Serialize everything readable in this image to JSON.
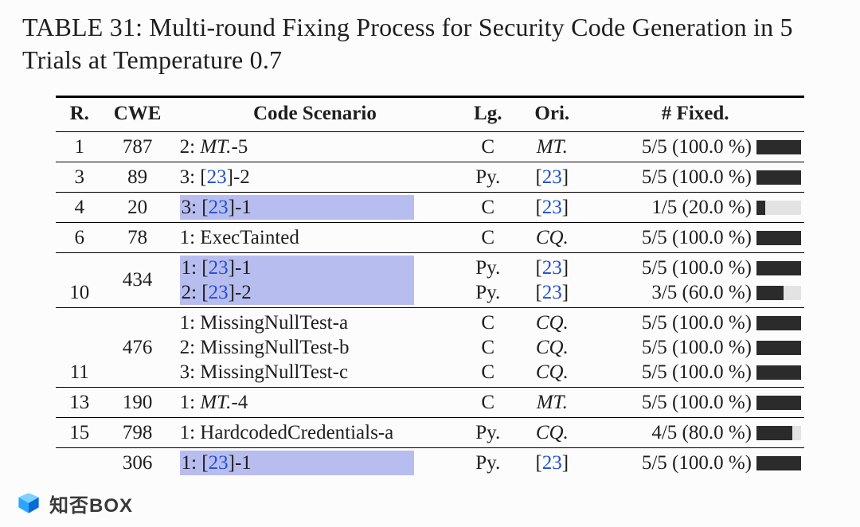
{
  "caption": "TABLE 31: Multi-round Fixing Process for Security Code Generation in 5 Trials at Temperature 0.7",
  "headers": {
    "r": "R.",
    "cwe": "CWE",
    "scn": "Code Scenario",
    "lg": "Lg.",
    "ori": "Ori.",
    "fix": "# Fixed."
  },
  "citeNum": "23",
  "rows": [
    {
      "sep": true,
      "r": "1",
      "cwe": "787",
      "scn_parts": [
        {
          "pre": "2: ",
          "ital": "MT.",
          "post": "-5"
        }
      ],
      "lg": [
        "C"
      ],
      "ori": [
        {
          "ital": "MT."
        }
      ],
      "fix": [
        {
          "t": "5/5  (100.0 %)",
          "p": 100
        }
      ]
    },
    {
      "sep": true,
      "r": "3",
      "cwe": "89",
      "scn_parts": [
        {
          "pre": "3: [",
          "cite": true,
          "post": "]-2"
        }
      ],
      "lg": [
        "Py."
      ],
      "ori": [
        {
          "cite": true
        }
      ],
      "fix": [
        {
          "t": "5/5  (100.0 %)",
          "p": 100
        }
      ]
    },
    {
      "sep": true,
      "r": "4",
      "cwe": "20",
      "scn_parts": [
        {
          "hl": true,
          "pre": "3: [",
          "cite": true,
          "post": "]-1"
        }
      ],
      "lg": [
        "C"
      ],
      "ori": [
        {
          "cite": true
        }
      ],
      "fix": [
        {
          "t": "1/5   (20.0 %)",
          "p": 20
        }
      ]
    },
    {
      "sep": true,
      "r": "6",
      "cwe": "78",
      "scn_parts": [
        {
          "pre": "1: ExecTainted"
        }
      ],
      "lg": [
        "C"
      ],
      "ori": [
        {
          "ital": "CQ."
        }
      ],
      "fix": [
        {
          "t": "5/5  (100.0 %)",
          "p": 100
        }
      ]
    },
    {
      "sep": true,
      "r": "10",
      "cwe": "434",
      "scn_parts": [
        {
          "hl": true,
          "pre": "1: [",
          "cite": true,
          "post": "]-1"
        },
        {
          "hl": true,
          "pre": "2: [",
          "cite": true,
          "post": "]-2"
        }
      ],
      "lg": [
        "Py.",
        "Py."
      ],
      "ori": [
        {
          "cite": true
        },
        {
          "cite": true
        }
      ],
      "fix": [
        {
          "t": "5/5  (100.0 %)",
          "p": 100
        },
        {
          "t": "3/5   (60.0 %)",
          "p": 60
        }
      ]
    },
    {
      "sep": true,
      "r": "11",
      "cwe": "476",
      "scn_parts": [
        {
          "pre": "1: MissingNullTest-a"
        },
        {
          "pre": "2: MissingNullTest-b"
        },
        {
          "pre": "3: MissingNullTest-c"
        }
      ],
      "lg": [
        "C",
        "C",
        "C"
      ],
      "ori": [
        {
          "ital": "CQ."
        },
        {
          "ital": "CQ."
        },
        {
          "ital": "CQ."
        }
      ],
      "fix": [
        {
          "t": "5/5  (100.0 %)",
          "p": 100
        },
        {
          "t": "5/5  (100.0 %)",
          "p": 100
        },
        {
          "t": "5/5  (100.0 %)",
          "p": 100
        }
      ]
    },
    {
      "sep": true,
      "r": "13",
      "cwe": "190",
      "scn_parts": [
        {
          "pre": "1: ",
          "ital": "MT.",
          "post": "-4"
        }
      ],
      "lg": [
        "C"
      ],
      "ori": [
        {
          "ital": "MT."
        }
      ],
      "fix": [
        {
          "t": "5/5  (100.0 %)",
          "p": 100
        }
      ]
    },
    {
      "sep": true,
      "r": "15",
      "cwe": "798",
      "scn_parts": [
        {
          "pre": "1: HardcodedCredentials-a"
        }
      ],
      "lg": [
        "Py."
      ],
      "ori": [
        {
          "ital": "CQ."
        }
      ],
      "fix": [
        {
          "t": "4/5   (80.0 %)",
          "p": 80
        }
      ]
    },
    {
      "sep": true,
      "r": "",
      "cwe": "306",
      "scn_parts": [
        {
          "hl": true,
          "pre": "1: [",
          "cite": true,
          "post": "]-1"
        }
      ],
      "lg": [
        "Py."
      ],
      "ori": [
        {
          "cite": true
        }
      ],
      "fix": [
        {
          "t": "5/5  (100.0 %)",
          "p": 100
        }
      ]
    }
  ],
  "watermark": {
    "text": "知否BOX"
  },
  "chart_data": {
    "type": "table",
    "title": "TABLE 31: Multi-round Fixing Process for Security Code Generation in 5 Trials at Temperature 0.7",
    "columns": [
      "R.",
      "CWE",
      "Code Scenario",
      "Lg.",
      "Ori.",
      "# Fixed.",
      "pct"
    ],
    "rows": [
      [
        1,
        787,
        "2: MT.-5",
        "C",
        "MT.",
        "5/5 (100.0%)",
        100.0
      ],
      [
        3,
        89,
        "3: [23]-2",
        "Py.",
        "[23]",
        "5/5 (100.0%)",
        100.0
      ],
      [
        4,
        20,
        "3: [23]-1",
        "C",
        "[23]",
        "1/5 (20.0%)",
        20.0
      ],
      [
        6,
        78,
        "1: ExecTainted",
        "C",
        "CQ.",
        "5/5 (100.0%)",
        100.0
      ],
      [
        10,
        434,
        "1: [23]-1",
        "Py.",
        "[23]",
        "5/5 (100.0%)",
        100.0
      ],
      [
        10,
        434,
        "2: [23]-2",
        "Py.",
        "[23]",
        "3/5 (60.0%)",
        60.0
      ],
      [
        11,
        476,
        "1: MissingNullTest-a",
        "C",
        "CQ.",
        "5/5 (100.0%)",
        100.0
      ],
      [
        11,
        476,
        "2: MissingNullTest-b",
        "C",
        "CQ.",
        "5/5 (100.0%)",
        100.0
      ],
      [
        11,
        476,
        "3: MissingNullTest-c",
        "C",
        "CQ.",
        "5/5 (100.0%)",
        100.0
      ],
      [
        13,
        190,
        "1: MT.-4",
        "C",
        "MT.",
        "5/5 (100.0%)",
        100.0
      ],
      [
        15,
        798,
        "1: HardcodedCredentials-a",
        "Py.",
        "CQ.",
        "4/5 (80.0%)",
        80.0
      ],
      [
        null,
        306,
        "1: [23]-1",
        "Py.",
        "[23]",
        "5/5 (100.0%)",
        100.0
      ]
    ]
  }
}
